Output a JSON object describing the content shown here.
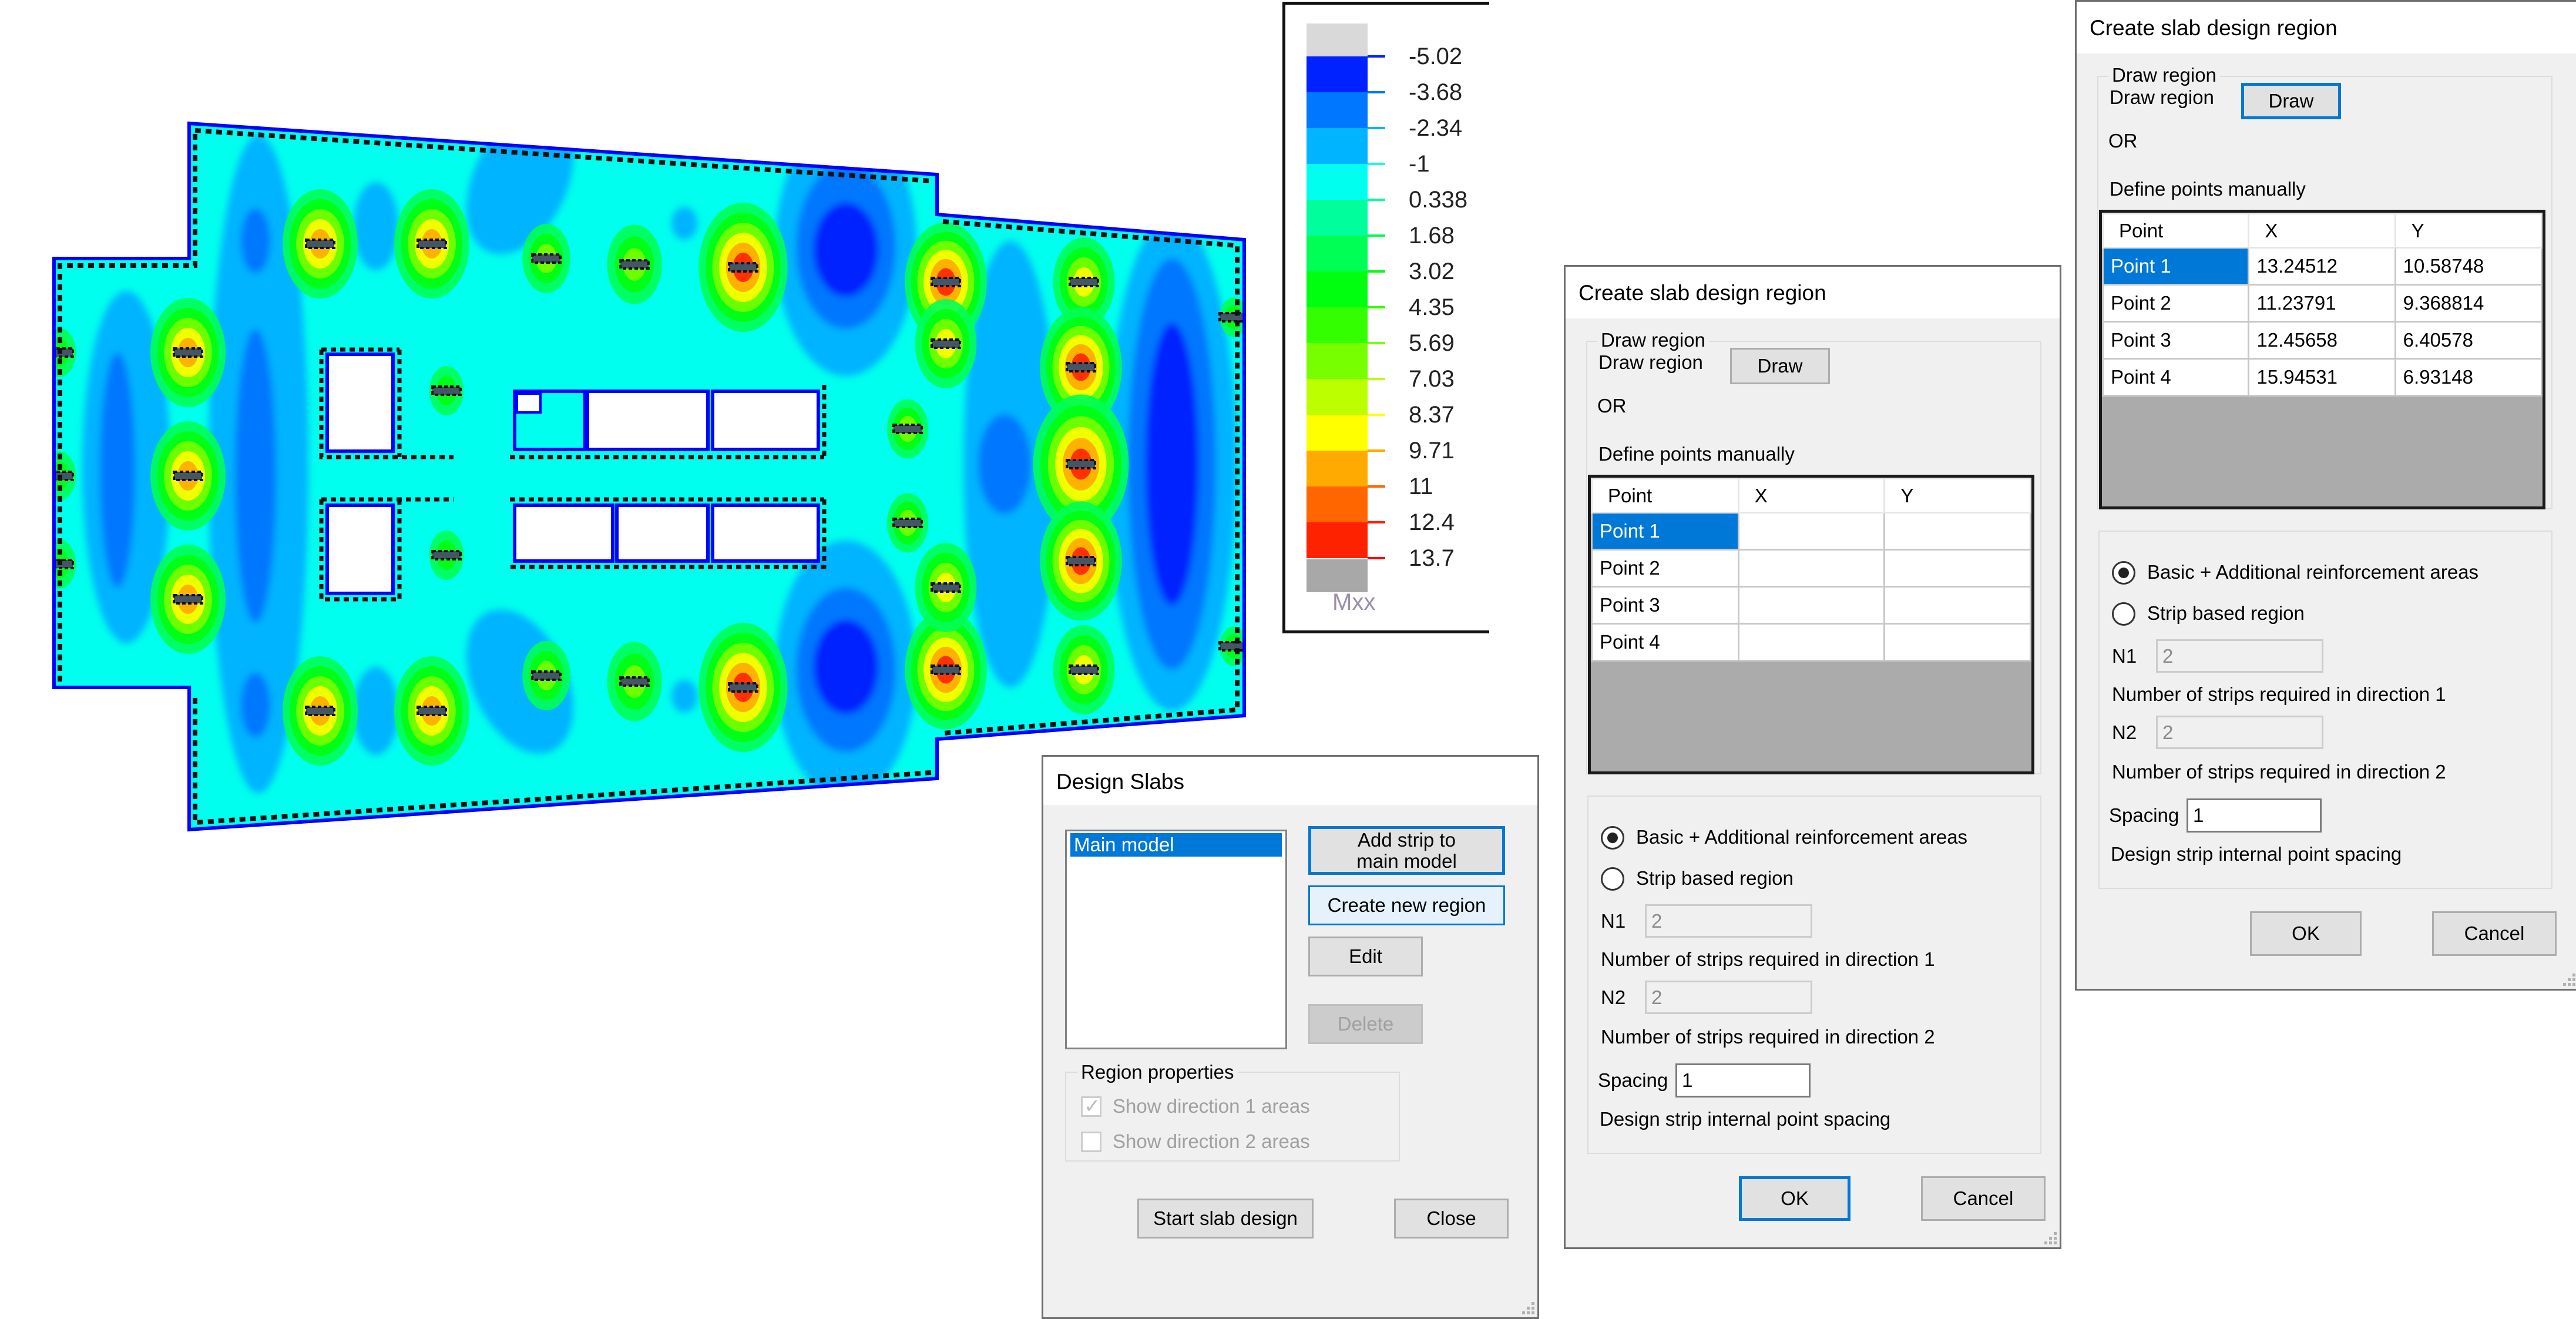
{
  "plot": {
    "result_label": "Mxx",
    "outline_color": "#0000ff",
    "opening_fill": "#ffffff"
  },
  "legend": {
    "title": "Mxx",
    "levels": [
      {
        "value": "-5.02",
        "color": "#0022ff"
      },
      {
        "value": "-3.68",
        "color": "#0077ff"
      },
      {
        "value": "-2.34",
        "color": "#00b4ff"
      },
      {
        "value": "-1",
        "color": "#00ffee"
      },
      {
        "value": "0.338",
        "color": "#00ff9c"
      },
      {
        "value": "1.68",
        "color": "#00ff55"
      },
      {
        "value": "3.02",
        "color": "#00ff0f"
      },
      {
        "value": "4.35",
        "color": "#33ff00"
      },
      {
        "value": "5.69",
        "color": "#77ff00"
      },
      {
        "value": "7.03",
        "color": "#bbff00"
      },
      {
        "value": "8.37",
        "color": "#ffff00"
      },
      {
        "value": "9.71",
        "color": "#ffaa00"
      },
      {
        "value": "11",
        "color": "#ff6600"
      },
      {
        "value": "12.4",
        "color": "#ff2200"
      },
      {
        "value": "13.7",
        "color": "#ff0000"
      }
    ],
    "above_color": "#d9d9d9",
    "below_color": "#a8a8a8"
  },
  "design_slabs": {
    "title": "Design Slabs",
    "list_items": [
      "Main model"
    ],
    "selected_item": "Main model",
    "buttons": {
      "add_strip": "Add strip to main model",
      "create_region": "Create new region",
      "edit": "Edit",
      "delete": "Delete",
      "start": "Start slab design",
      "close": "Close"
    },
    "region_properties": {
      "caption": "Region properties",
      "show_dir1": {
        "label": "Show direction 1 areas",
        "checked": true,
        "enabled": false
      },
      "show_dir2": {
        "label": "Show direction 2 areas",
        "checked": false,
        "enabled": false
      }
    }
  },
  "region_dialogs": [
    {
      "title": "Create slab design region",
      "draw_group_caption": "Draw region",
      "draw_label": "Draw region",
      "draw_button": "Draw",
      "or_label": "OR",
      "define_label": "Define points manually",
      "columns": [
        "Point",
        "X",
        "Y"
      ],
      "rows": [
        {
          "point": "Point 1",
          "x": "",
          "y": ""
        },
        {
          "point": "Point 2",
          "x": "",
          "y": ""
        },
        {
          "point": "Point 3",
          "x": "",
          "y": ""
        },
        {
          "point": "Point 4",
          "x": "",
          "y": ""
        }
      ],
      "selected_row": 0,
      "option_basic": "Basic + Additional reinforcement areas",
      "option_strip": "Strip based region",
      "selected_option": "basic",
      "n1_label": "N1",
      "n1_value": "2",
      "n1_desc": "Number of strips required in direction 1",
      "n2_label": "N2",
      "n2_value": "2",
      "n2_desc": "Number of strips required in direction 2",
      "spacing_label": "Spacing",
      "spacing_value": "1",
      "spacing_desc": "Design strip internal point spacing",
      "ok": "OK",
      "cancel": "Cancel",
      "focused": "ok"
    },
    {
      "title": "Create slab design region",
      "draw_group_caption": "Draw region",
      "draw_label": "Draw region",
      "draw_button": "Draw",
      "or_label": "OR",
      "define_label": "Define points manually",
      "columns": [
        "Point",
        "X",
        "Y"
      ],
      "rows": [
        {
          "point": "Point 1",
          "x": "13.24512",
          "y": "10.58748"
        },
        {
          "point": "Point 2",
          "x": "11.23791",
          "y": "9.368814"
        },
        {
          "point": "Point 3",
          "x": "12.45658",
          "y": "6.40578"
        },
        {
          "point": "Point 4",
          "x": "15.94531",
          "y": "6.93148"
        }
      ],
      "selected_row": 0,
      "option_basic": "Basic + Additional reinforcement areas",
      "option_strip": "Strip based region",
      "selected_option": "basic",
      "n1_label": "N1",
      "n1_value": "2",
      "n1_desc": "Number of strips required in direction 1",
      "n2_label": "N2",
      "n2_value": "2",
      "n2_desc": "Number of strips required in direction 2",
      "spacing_label": "Spacing",
      "spacing_value": "1",
      "spacing_desc": "Design strip internal point spacing",
      "ok": "OK",
      "cancel": "Cancel",
      "focused": "draw"
    }
  ]
}
